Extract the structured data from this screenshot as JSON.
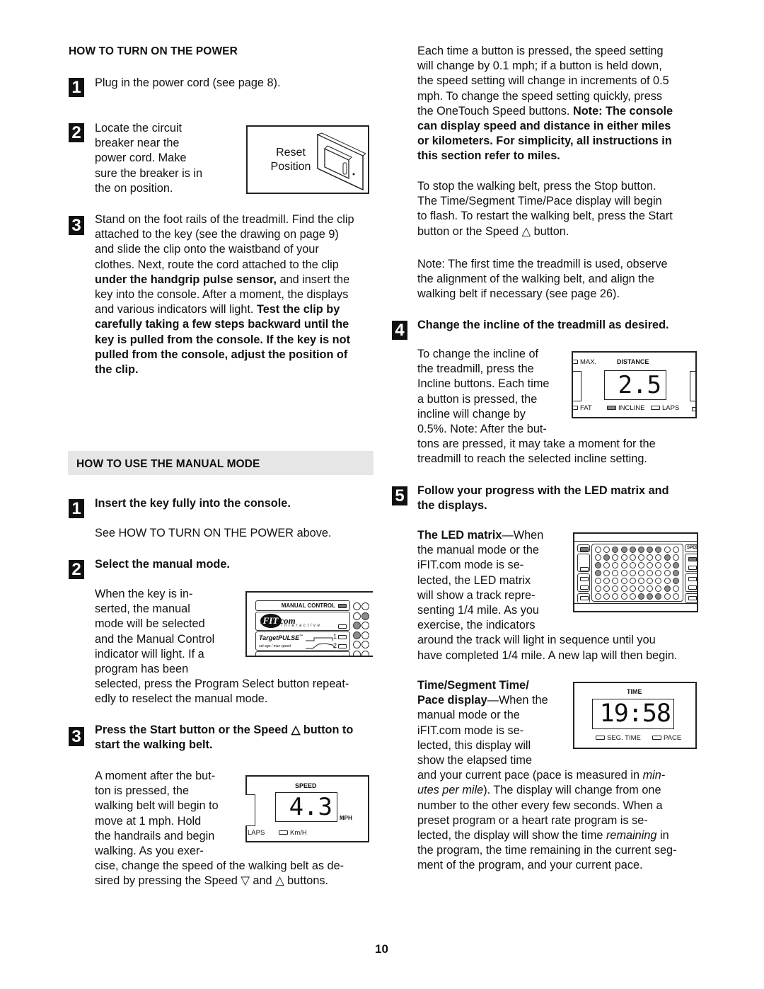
{
  "page_number": "10",
  "power": {
    "heading": "HOW TO TURN ON THE POWER",
    "step1": {
      "num": "1",
      "text": "Plug in the power cord (see page 8)."
    },
    "step2": {
      "num": "2",
      "lines": [
        "Locate the circuit",
        "breaker near the",
        "power cord. Make",
        "sure the breaker is in",
        "the on position."
      ],
      "figure": {
        "label_line1": "Reset",
        "label_line2": "Position"
      }
    },
    "step3": {
      "num": "3",
      "l1": "Stand on the foot rails of the treadmill. Find the clip",
      "l2": "attached to the key (see the drawing on page 9)",
      "l3": "and slide the clip onto the waistband of your",
      "l4": "clothes. Next, route the cord attached to the clip",
      "l5_bold": "under the handgrip pulse sensor,",
      "l5_rest": " and insert the",
      "l6": "key into the console. After a moment, the displays",
      "l7_plain": "and various indicators will light. ",
      "l7_bold": "Test the clip by",
      "l8": "carefully taking a few steps backward until the",
      "l9": "key is pulled from the console. If the key is not",
      "l10": "pulled from the console, adjust the position of",
      "l11": "the clip."
    }
  },
  "manual": {
    "heading": "HOW TO USE THE MANUAL MODE",
    "step1": {
      "num": "1",
      "title": "Insert the key fully into the console.",
      "text": "See HOW TO TURN ON THE POWER above."
    },
    "step2": {
      "num": "2",
      "title": "Select the manual mode.",
      "lines": [
        "When the key is in-",
        "serted, the manual",
        "mode will be selected",
        "and the Manual Control",
        "indicator will light. If a",
        "program has been"
      ],
      "tail": [
        "selected, press the Program Select button repeat-",
        "edly to reselect the manual mode."
      ],
      "figure": {
        "manual_control": "MANUAL CONTROL",
        "ifit_i": "i",
        "ifit_fit": "FIT",
        "ifit_com": ".com",
        "interactive": "i n t e r a c t i v e",
        "targetpulse": "TargetPULSE",
        "tm": "™",
        "set_age": "set age / max speed",
        "prog1": "1",
        "prog2": "2"
      }
    },
    "step3": {
      "num": "3",
      "title_l1": "Press the Start button or the Speed △ button to",
      "title_l2": "start the walking belt.",
      "lines": [
        "A moment after the but-",
        "ton is pressed, the",
        "walking belt will begin to",
        "move at 1 mph. Hold",
        "the handrails and begin",
        "walking. As you exer-"
      ],
      "tail": [
        "cise, change the speed of the walking belt as de-",
        "sired by pressing the Speed ▽ and △ buttons."
      ],
      "figure": {
        "title": "SPEED",
        "value": "4.3",
        "unit": "MPH",
        "laps": "LAPS",
        "kmh": "Km/H"
      }
    }
  },
  "right": {
    "para1": {
      "l1": "Each time a button is pressed, the speed setting",
      "l2": "will change by 0.1 mph; if a button is held down,",
      "l3": "the speed setting will change in increments of 0.5",
      "l4": "mph. To change the speed setting quickly, press",
      "l5_plain": "the OneTouch Speed buttons. ",
      "l5_bold": "Note: The console",
      "l6": "can display speed and distance in either miles",
      "l7": "or kilometers. For simplicity, all instructions in",
      "l8": "this section refer to miles."
    },
    "para2": [
      "To stop the walking belt, press the Stop button.",
      "The Time/Segment Time/Pace display will begin",
      "to flash. To restart the walking belt, press the Start",
      "button or the Speed △ button."
    ],
    "para3": [
      "Note: The first time the treadmill is used, observe",
      "the alignment of the walking belt, and align the",
      "walking belt if necessary (see page 26)."
    ],
    "step4": {
      "num": "4",
      "title": "Change the incline of the treadmill as desired.",
      "lines": [
        "To change the incline of",
        "the treadmill, press the",
        "Incline buttons. Each time",
        "a button is pressed, the",
        "incline will change by",
        "0.5%. Note: After the but-"
      ],
      "tail": [
        "tons are pressed, it may take a moment for the",
        "treadmill to reach the selected incline setting."
      ],
      "figure": {
        "max": "MAX.",
        "title": "DISTANCE",
        "value": "2.5",
        "fat": "FAT",
        "incline": "INCLINE",
        "laps": "LAPS"
      }
    },
    "step5": {
      "num": "5",
      "title_l1": "Follow your progress with the LED matrix and",
      "title_l2": "the displays.",
      "led": {
        "title_bold": "The LED matrix",
        "title_rest": "—When",
        "lines": [
          "the manual mode or the",
          "iFIT.com mode is se-",
          "lected, the LED matrix",
          "will show a track repre-",
          "senting 1/4 mile. As you",
          "exercise, the indicators"
        ],
        "tail": [
          "around the track will light in sequence until you",
          "have completed 1/4 mile. A new lap will then begin."
        ],
        "figure": {
          "speed_label": "SPEE",
          "matrix": [
            [
              0,
              0,
              1,
              1,
              1,
              1,
              1,
              1,
              0,
              0
            ],
            [
              0,
              1,
              0,
              0,
              0,
              0,
              0,
              0,
              1,
              0
            ],
            [
              1,
              0,
              0,
              0,
              0,
              0,
              0,
              0,
              0,
              1
            ],
            [
              1,
              0,
              0,
              0,
              0,
              0,
              0,
              0,
              0,
              1
            ],
            [
              0,
              0,
              0,
              0,
              0,
              0,
              0,
              0,
              0,
              1
            ],
            [
              0,
              0,
              0,
              0,
              0,
              0,
              0,
              0,
              1,
              0
            ],
            [
              0,
              0,
              0,
              0,
              0,
              1,
              1,
              1,
              0,
              0
            ]
          ]
        }
      },
      "time": {
        "title_l1": "Time/Segment Time/",
        "title_l2_bold": "Pace display",
        "title_l2_rest": "—When the",
        "lines": [
          "manual mode or the",
          "iFIT.com mode is se-",
          "lected, this display will",
          "show the elapsed time"
        ],
        "tail_l1_plain": "and your current pace (pace is measured in ",
        "tail_l1_italic": "min-",
        "tail_l2_italic": "utes per mile",
        "tail_l2_plain": "). The display will change from one",
        "tail_l3": "number to the other every few seconds. When a",
        "tail_l4": "preset program or a heart rate program is se-",
        "tail_l5_plain": "lected, the display will show the time ",
        "tail_l5_italic": "remaining",
        "tail_l5_rest": " in",
        "tail_l6": "the program, the time remaining in the current seg-",
        "tail_l7": "ment of the program, and your current pace.",
        "figure": {
          "title": "TIME",
          "value": "19:58",
          "seg_time": "SEG. TIME",
          "pace": "PACE"
        }
      }
    }
  }
}
